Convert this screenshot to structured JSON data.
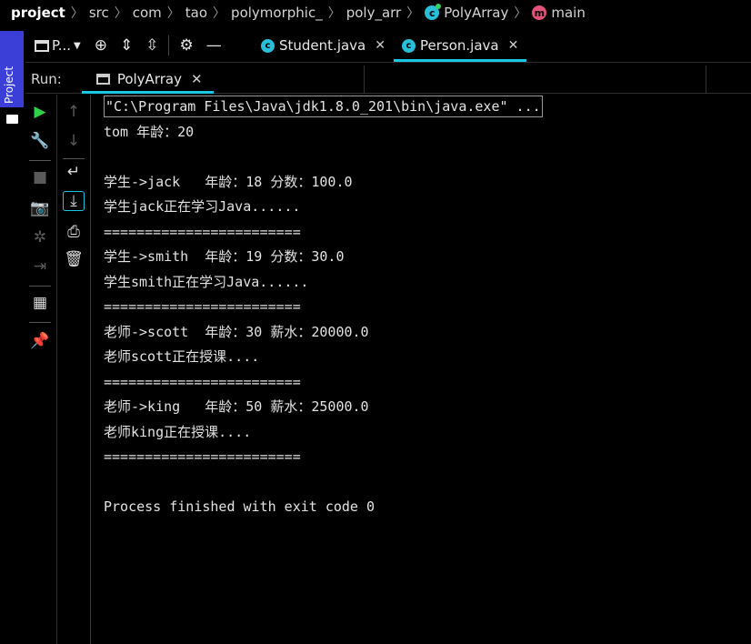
{
  "breadcrumb": {
    "items": [
      "project",
      "src",
      "com",
      "tao",
      "polymorphic_",
      "poly_arr",
      "PolyArray",
      "main"
    ],
    "class_icon_letter": "c",
    "method_icon_letter": "m"
  },
  "project_strip": {
    "label": "Project"
  },
  "tool_header": {
    "dropdown_label": "P..."
  },
  "editor_tabs": [
    {
      "label": "Student.java",
      "icon_letter": "c"
    },
    {
      "label": "Person.java",
      "icon_letter": "c"
    }
  ],
  "run": {
    "label": "Run:",
    "tab_label": "PolyArray"
  },
  "console": {
    "lines": [
      "\"C:\\Program Files\\Java\\jdk1.8.0_201\\bin\\java.exe\" ...",
      "tom 年龄：20",
      "",
      "学生->jack   年龄：18 分数：100.0",
      "学生jack正在学习Java......",
      "========================",
      "学生->smith  年龄：19 分数：30.0",
      "学生smith正在学习Java......",
      "========================",
      "老师->scott  年龄：30 薪水：20000.0",
      "老师scott正在授课....",
      "========================",
      "老师->king   年龄：50 薪水：25000.0",
      "老师king正在授课....",
      "========================",
      "",
      "Process finished with exit code 0"
    ]
  },
  "colors": {
    "accent": "#19c6e4",
    "run_green": "#2fd34a",
    "project_strip": "#3b3fd8",
    "class_icon": "#27c0d8",
    "method_icon": "#e4527a"
  }
}
